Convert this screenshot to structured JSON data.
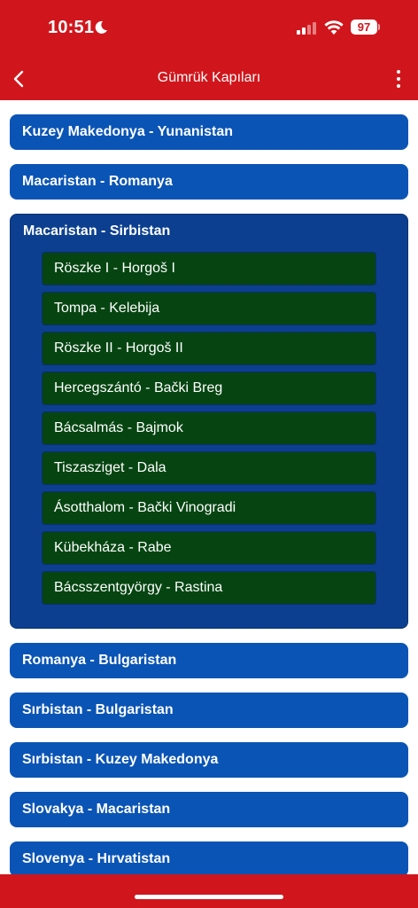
{
  "status_bar": {
    "time": "10:51",
    "battery": "97"
  },
  "nav": {
    "title": "Gümrük Kapıları"
  },
  "colors": {
    "header": "#d0161c",
    "group": "#0a54b5",
    "group_expanded": "#0c3f8f",
    "sub_item": "#064512"
  },
  "groups": [
    {
      "label": "Kuzey Makedonya - Yunanistan"
    },
    {
      "label": "Macaristan - Romanya"
    },
    {
      "label": "Macaristan - Sirbistan",
      "expanded": true,
      "items": [
        "Röszke I - Horgoš I",
        "Tompa - Kelebija",
        "Röszke II - Horgoš II",
        "Hercegszántó - Bački Breg",
        "Bácsalmás - Bajmok",
        "Tiszasziget - Dala",
        "Ásotthalom - Bački Vinogradi",
        "Kübekháza - Rabe",
        "Bácsszentgyörgy - Rastina"
      ]
    },
    {
      "label": "Romanya - Bulgaristan"
    },
    {
      "label": "Sırbistan - Bulgaristan"
    },
    {
      "label": "Sırbistan - Kuzey Makedonya"
    },
    {
      "label": "Slovakya - Macaristan"
    },
    {
      "label": "Slovenya - Hırvatistan"
    }
  ]
}
